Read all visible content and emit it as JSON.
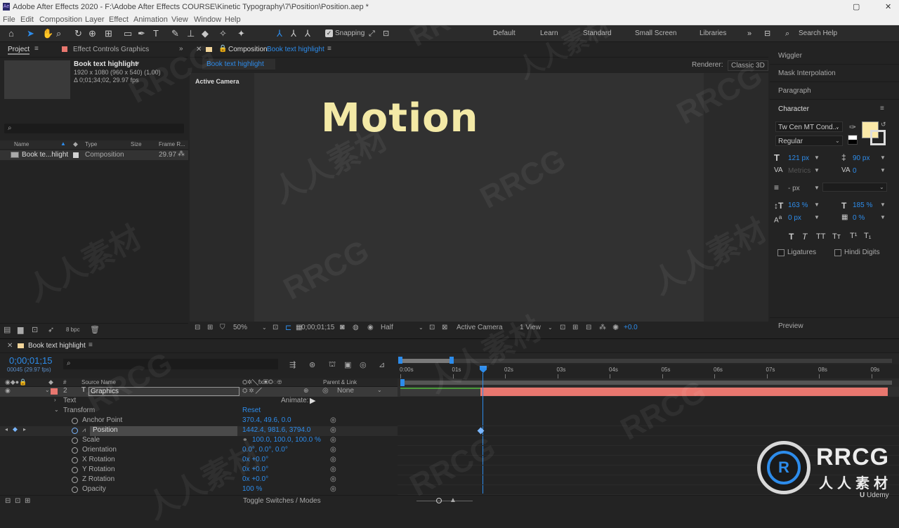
{
  "titlebar": {
    "title": "Adobe After Effects 2020 - F:\\Adobe After Effects COURSE\\Kinetic Typography\\7\\Position\\Position.aep *",
    "app_icon": "Ae"
  },
  "menu": [
    "File",
    "Edit",
    "Composition",
    "Layer",
    "Effect",
    "Animation",
    "View",
    "Window",
    "Help"
  ],
  "toolbar": {
    "snapping": "Snapping",
    "workspaces": [
      "Default",
      "Learn",
      "Standard",
      "Small Screen",
      "Libraries"
    ],
    "search_help": "Search Help"
  },
  "project": {
    "tab": "Project",
    "effect_controls": "Effect Controls Graphics",
    "item_name": "Book text highlight",
    "item_dims": "1920 x 1080  (960 x 540) (1.00)",
    "item_dur": "Δ 0;01;34;02, 29.97 fps",
    "cols": {
      "name": "Name",
      "type": "Type",
      "size": "Size",
      "fps": "Frame R..."
    },
    "row": {
      "name": "Book te...hlight",
      "type": "Composition",
      "fps": "29.97"
    },
    "bpc": "8 bpc"
  },
  "comp": {
    "tab_prefix": "Composition",
    "tab_name": "Book text highlight",
    "breadcrumb": "Book text highlight",
    "renderer_label": "Renderer:",
    "renderer": "Classic 3D",
    "active_camera": "Active Camera",
    "text": "Motion",
    "text_color": "#f3e9a6",
    "zoom": "50%",
    "time": "0;00;01;15",
    "quality": "Half",
    "camera": "Active Camera",
    "view": "1 View",
    "exposure": "+0.0"
  },
  "right": {
    "wiggler": "Wiggler",
    "mask_interp": "Mask Interpolation",
    "paragraph": "Paragraph",
    "character": "Character",
    "font": "Tw Cen MT Cond...",
    "style": "Regular",
    "size": "121 px",
    "leading": "90 px",
    "kerning": "Metrics",
    "tracking": "0",
    "stroke": "- px",
    "vscale": "163 %",
    "hscale": "185 %",
    "baseline": "0 px",
    "tsume": "0 %",
    "ligatures": "Ligatures",
    "hindi": "Hindi Digits",
    "preview": "Preview",
    "fill_color": "#fbe9a8"
  },
  "timeline": {
    "tab": "Book text highlight",
    "timecode": "0;00;01;15",
    "frames": "00045 (29.97 fps)",
    "col_source": "Source Name",
    "col_parent": "Parent & Link",
    "layer_num": "2",
    "layer_name": "Graphics",
    "parent": "None",
    "animate": "Animate:",
    "text": "Text",
    "transform": "Transform",
    "reset": "Reset",
    "props": [
      {
        "name": "Anchor Point",
        "value": "370.4, 49.6, 0.0"
      },
      {
        "name": "Position",
        "value": "1442.4, 981.6, 3794.0"
      },
      {
        "name": "Scale",
        "value": "100.0, 100.0, 100.0 %"
      },
      {
        "name": "Orientation",
        "value": "0.0°, 0.0°, 0.0°"
      },
      {
        "name": "X Rotation",
        "value": "0x +0.0°"
      },
      {
        "name": "Y Rotation",
        "value": "0x +0.0°"
      },
      {
        "name": "Z Rotation",
        "value": "0x +0.0°"
      },
      {
        "name": "Opacity",
        "value": "100 %"
      }
    ],
    "toggle": "Toggle Switches / Modes",
    "ruler": [
      "0:00s",
      "01s",
      "02s",
      "03s",
      "04s",
      "05s",
      "06s",
      "07s",
      "08s",
      "09s"
    ],
    "layer_bar_color": "#e8776f"
  },
  "watermark": {
    "main": "RRCG",
    "sub": "人人素材",
    "cn_repeat": "人人素材"
  },
  "udemy": "Udemy"
}
